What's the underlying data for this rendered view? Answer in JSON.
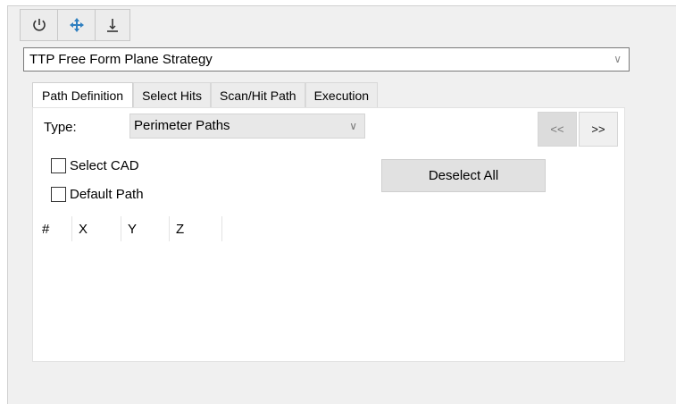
{
  "toolbar": {
    "buttons": [
      {
        "icon": "power-icon"
      },
      {
        "icon": "move-arrows-icon",
        "color": "#2f7fc0"
      },
      {
        "icon": "down-bar-icon"
      }
    ]
  },
  "strategy": {
    "value": "TTP Free Form Plane Strategy",
    "arrow": "∨"
  },
  "tabs": [
    {
      "label": "Path Definition",
      "active": true
    },
    {
      "label": "Select Hits"
    },
    {
      "label": "Scan/Hit Path"
    },
    {
      "label": "Execution"
    }
  ],
  "form": {
    "type_label": "Type:",
    "type_value": "Perimeter Paths",
    "type_arrow": "∨",
    "prev_label": "<<",
    "next_label": ">>",
    "select_cad_label": "Select CAD",
    "select_cad_checked": false,
    "default_path_label": "Default Path",
    "default_path_checked": false,
    "deselect_all_label": "Deselect All"
  },
  "table": {
    "columns": [
      "#",
      "X",
      "Y",
      "Z"
    ]
  }
}
